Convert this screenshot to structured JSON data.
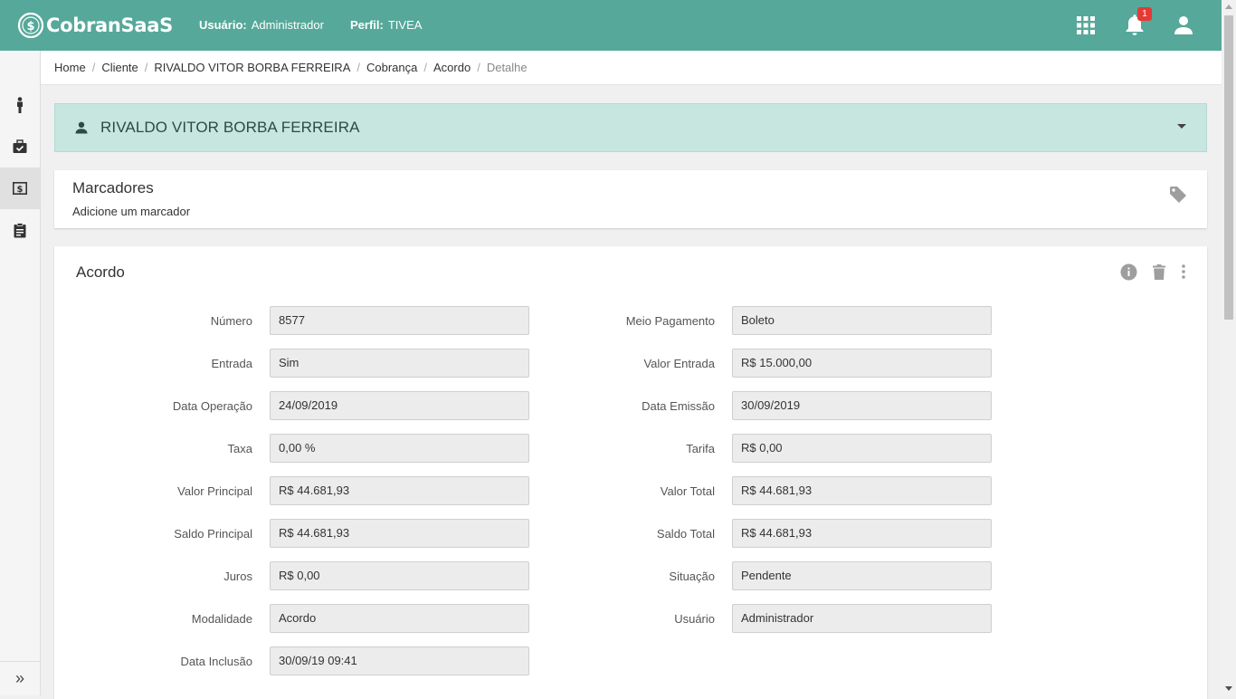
{
  "header": {
    "brand": "CobranSaaS",
    "user_label": "Usuário:",
    "user_value": "Administrador",
    "profile_label": "Perfil:",
    "profile_value": "TIVEA",
    "notification_count": "1",
    "bar_color": "#56a89a"
  },
  "breadcrumb": [
    "Home",
    "Cliente",
    "RIVALDO VITOR BORBA FERREIRA",
    "Cobrança",
    "Acordo",
    "Detalhe"
  ],
  "client": {
    "name": "RIVALDO VITOR BORBA FERREIRA"
  },
  "tags": {
    "title": "Marcadores",
    "add_label": "Adicione um marcador"
  },
  "acordo": {
    "title": "Acordo",
    "left_fields": [
      {
        "label": "Número",
        "value": "8577"
      },
      {
        "label": "Entrada",
        "value": "Sim"
      },
      {
        "label": "Data Operação",
        "value": "24/09/2019"
      },
      {
        "label": "Taxa",
        "value": "0,00 %"
      },
      {
        "label": "Valor Principal",
        "value": "R$ 44.681,93"
      },
      {
        "label": "Saldo Principal",
        "value": "R$ 44.681,93"
      },
      {
        "label": "Juros",
        "value": "R$ 0,00"
      },
      {
        "label": "Modalidade",
        "value": "Acordo"
      },
      {
        "label": "Data Inclusão",
        "value": "30/09/19 09:41"
      }
    ],
    "right_fields": [
      {
        "label": "Meio Pagamento",
        "value": "Boleto"
      },
      {
        "label": "Valor Entrada",
        "value": "R$ 15.000,00"
      },
      {
        "label": "Data Emissão",
        "value": "30/09/2019"
      },
      {
        "label": "Tarifa",
        "value": "R$ 0,00"
      },
      {
        "label": "Valor Total",
        "value": "R$ 44.681,93"
      },
      {
        "label": "Saldo Total",
        "value": "R$ 44.681,93"
      },
      {
        "label": "Situação",
        "value": "Pendente"
      },
      {
        "label": "Usuário",
        "value": "Administrador"
      }
    ]
  },
  "sidebar": {
    "items": [
      {
        "icon": "person-icon"
      },
      {
        "icon": "briefcase-check-icon"
      },
      {
        "icon": "money-icon",
        "active": true
      },
      {
        "icon": "clipboard-icon"
      }
    ],
    "expand_glyph": "»"
  }
}
